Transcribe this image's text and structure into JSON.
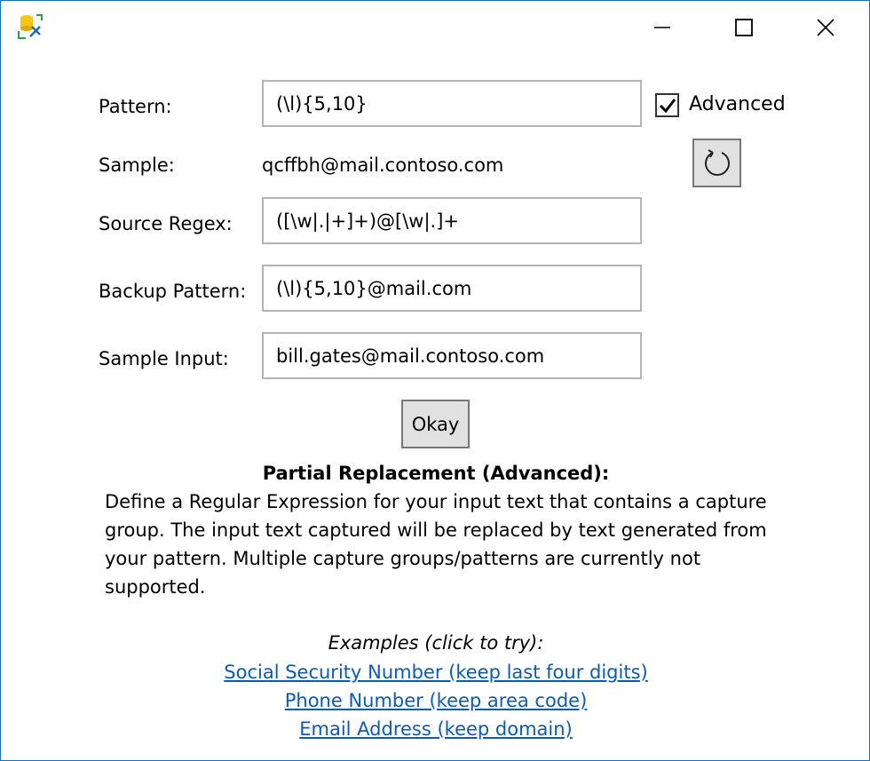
{
  "titlebar": {
    "icons": {
      "app": "app-icon",
      "minimize": "minimize-icon",
      "maximize": "maximize-icon",
      "close": "close-icon"
    }
  },
  "form": {
    "pattern_label": "Pattern:",
    "pattern_value": "(\\l){5,10}",
    "sample_label": "Sample:",
    "sample_value": "qcffbh@mail.contoso.com",
    "source_regex_label": "Source Regex:",
    "source_regex_value": "([\\w|.|+]+)@[\\w|.]+",
    "backup_pattern_label": "Backup Pattern:",
    "backup_pattern_value": "(\\l){5,10}@mail.com",
    "sample_input_label": "Sample Input:",
    "sample_input_value": "bill.gates@mail.contoso.com",
    "advanced_label": "Advanced",
    "advanced_checked": true,
    "okay_label": "Okay"
  },
  "description": {
    "title": "Partial Replacement (Advanced):",
    "body": "Define a Regular Expression for your input text that contains a capture group. The input text captured will be replaced by text generated from your pattern. Multiple capture groups/patterns are currently not supported."
  },
  "examples": {
    "title": "Examples (click to try):",
    "links": [
      "Social Security Number (keep last four digits)",
      "Phone Number (keep area code)",
      "Email Address (keep domain)"
    ]
  },
  "colors": {
    "accent": "#1a6fb3",
    "link": "#0b5bb5",
    "button_bg": "#e1e1e1"
  }
}
